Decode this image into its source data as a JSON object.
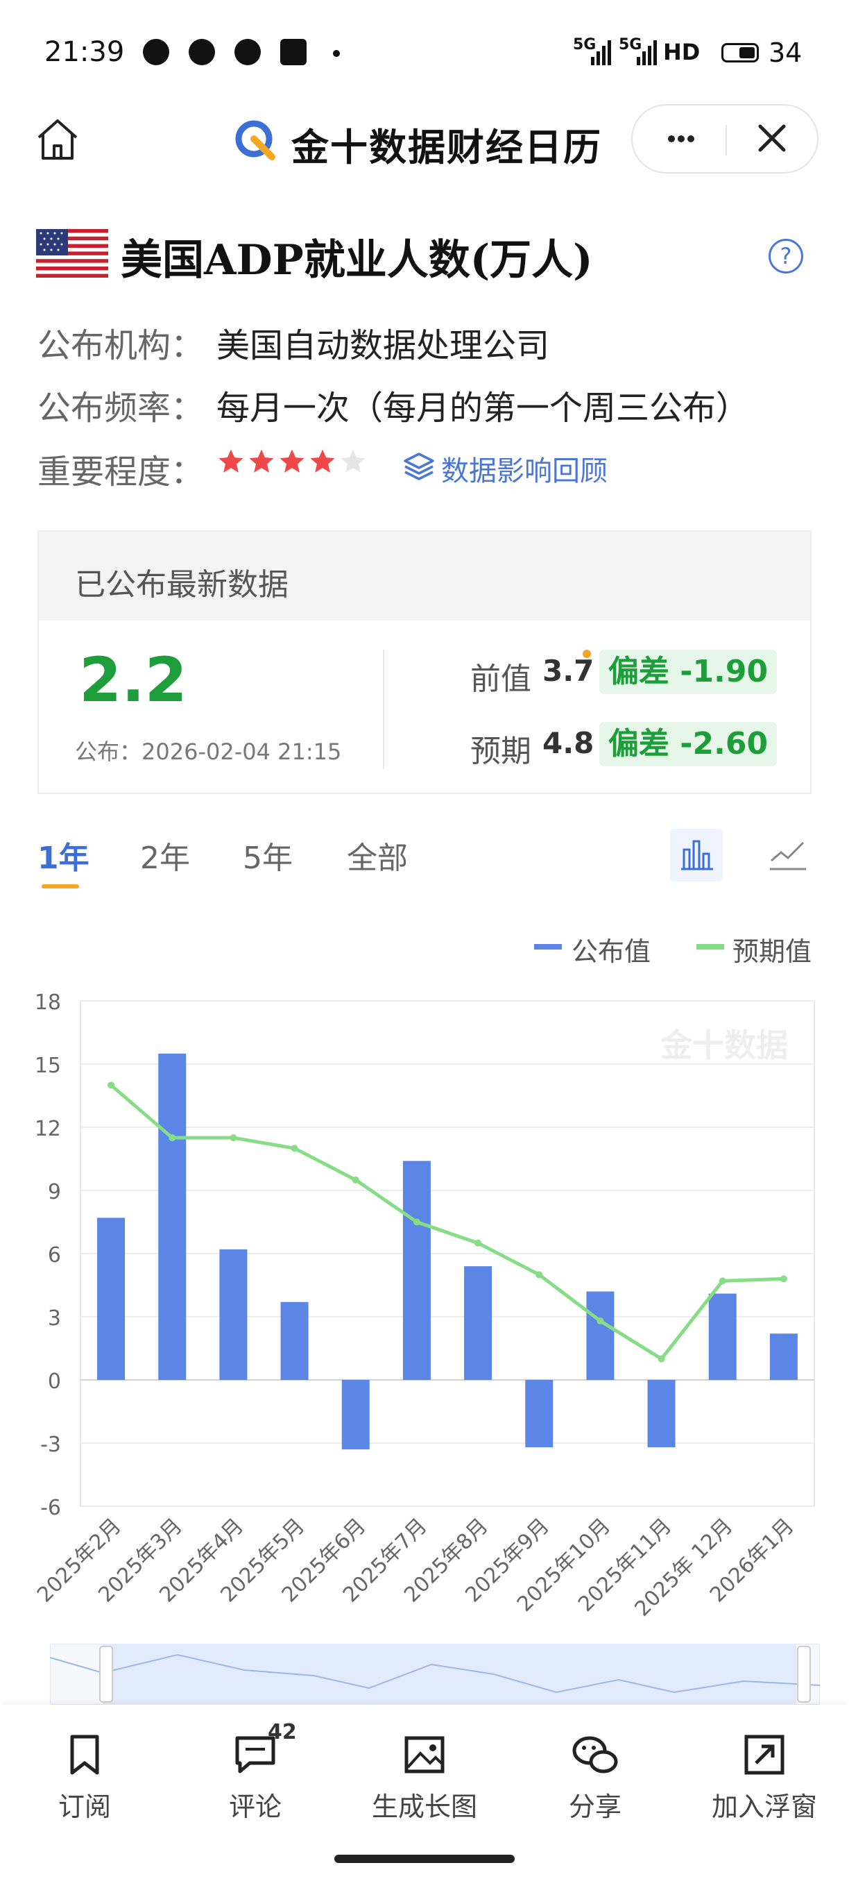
{
  "status_bar": {
    "time": "21:39",
    "signal_1": "5G",
    "signal_2": "5G",
    "network": "HD",
    "battery": "34"
  },
  "header": {
    "title": "金十数据财经日历",
    "home_icon": "home-icon",
    "more_icon": "more-icon",
    "close_icon": "close-icon"
  },
  "indicator": {
    "title": "美国ADP就业人数(万人)",
    "publisher_label": "公布机构：",
    "publisher": "美国自动数据处理公司",
    "frequency_label": "公布频率：",
    "frequency": "每月一次（每月的第一个周三公布）",
    "importance_label": "重要程度：",
    "importance_stars": 4,
    "importance_max": 5,
    "impact_link": "数据影响回顾",
    "help": "?"
  },
  "latest": {
    "title": "已公布最新数据",
    "actual": "2.2",
    "publish_time": "公布：2026-02-04 21:15",
    "previous_label": "前值",
    "previous": "3.7",
    "previous_deviation": "偏差 -1.90",
    "forecast_label": "预期",
    "forecast": "4.8",
    "forecast_deviation": "偏差 -2.60"
  },
  "tabs": {
    "y1": "1年",
    "y2": "2年",
    "y5": "5年",
    "all": "全部"
  },
  "legend": {
    "actual": "公布值",
    "expected": "预期值"
  },
  "watermark": "金十数据",
  "colors": {
    "bar": "#5b86e5",
    "line": "#86dd86",
    "accent": "#3b6fd6",
    "positive": "#1e9e3a",
    "star": "#f04848"
  },
  "chart_data": {
    "type": "bar",
    "categories": [
      "2025年2月",
      "2025年3月",
      "2025年4月",
      "2025年5月",
      "2025年6月",
      "2025年7月",
      "2025年8月",
      "2025年9月",
      "2025年10月",
      "2025年11月",
      "2025年 12月",
      "2026年1月"
    ],
    "series": [
      {
        "name": "公布值",
        "type": "bar",
        "values": [
          7.7,
          15.5,
          6.2,
          3.7,
          -3.3,
          10.4,
          5.4,
          -3.2,
          4.2,
          -3.2,
          4.1,
          2.2
        ]
      },
      {
        "name": "预期值",
        "type": "line",
        "values": [
          14.0,
          11.5,
          11.5,
          11.0,
          9.5,
          7.5,
          6.5,
          5.0,
          2.8,
          1.0,
          4.7,
          4.8
        ]
      }
    ],
    "yticks": [
      18,
      15,
      12,
      9,
      6,
      3,
      0,
      -3,
      -6
    ],
    "ylim": [
      -6,
      18
    ],
    "grid": true,
    "legend": "top-right"
  },
  "bottom_nav": [
    {
      "label": "订阅",
      "icon": "bookmark-icon"
    },
    {
      "label": "评论",
      "icon": "comment-icon",
      "badge": "42"
    },
    {
      "label": "生成长图",
      "icon": "image-icon"
    },
    {
      "label": "分享",
      "icon": "wechat-icon"
    },
    {
      "label": "加入浮窗",
      "icon": "float-window-icon"
    }
  ]
}
